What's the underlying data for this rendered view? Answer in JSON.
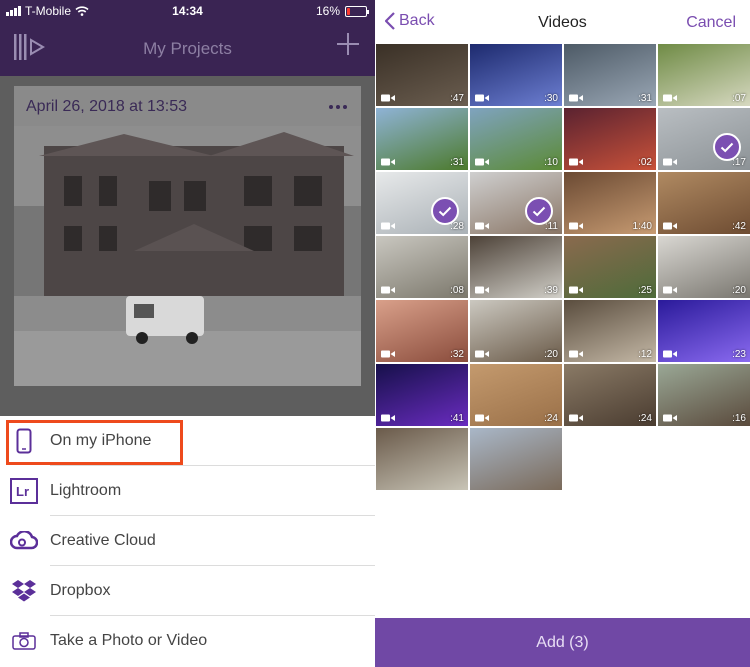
{
  "status_bar": {
    "carrier": "T-Mobile",
    "time": "14:34",
    "battery": "16%"
  },
  "left_header": {
    "title": "My Projects",
    "icons": [
      "app-logo-icon",
      "plus-icon"
    ]
  },
  "project": {
    "date": "April 26, 2018 at 13:53"
  },
  "import_menu": [
    {
      "label": "On my iPhone",
      "icon": "phone-icon"
    },
    {
      "label": "Lightroom",
      "icon": "lightroom-icon"
    },
    {
      "label": "Creative Cloud",
      "icon": "creative-cloud-icon"
    },
    {
      "label": "Dropbox",
      "icon": "dropbox-icon"
    },
    {
      "label": "Take a Photo or Video",
      "icon": "camera-icon"
    }
  ],
  "picker": {
    "back_label": "Back",
    "title": "Videos",
    "cancel_label": "Cancel",
    "add_label": "Add (3)"
  },
  "videos": [
    {
      "duration": ":47",
      "selected": false,
      "colors": [
        "#3a3026",
        "#6b5e50"
      ]
    },
    {
      "duration": ":30",
      "selected": false,
      "colors": [
        "#1d2a6e",
        "#6d7fd2"
      ]
    },
    {
      "duration": ":31",
      "selected": false,
      "colors": [
        "#4d5a66",
        "#9aa7b5"
      ]
    },
    {
      "duration": ":07",
      "selected": false,
      "colors": [
        "#6f8b45",
        "#d6d8c0"
      ]
    },
    {
      "duration": ":31",
      "selected": false,
      "colors": [
        "#8fb3d6",
        "#4c7a2c"
      ]
    },
    {
      "duration": ":10",
      "selected": false,
      "colors": [
        "#7fa3bf",
        "#5b8a35"
      ]
    },
    {
      "duration": ":02",
      "selected": false,
      "colors": [
        "#5a2230",
        "#c9523a"
      ]
    },
    {
      "duration": ":17",
      "selected": true,
      "colors": [
        "#b9bec2",
        "#8c9296"
      ]
    },
    {
      "duration": ":28",
      "selected": true,
      "colors": [
        "#e7e9ea",
        "#aab1b6"
      ]
    },
    {
      "duration": ":11",
      "selected": true,
      "colors": [
        "#cfcfcf",
        "#8a7666"
      ]
    },
    {
      "duration": "1:40",
      "selected": false,
      "colors": [
        "#6b4a33",
        "#c79b72"
      ]
    },
    {
      "duration": ":42",
      "selected": false,
      "colors": [
        "#b08a62",
        "#6e4c32"
      ]
    },
    {
      "duration": ":08",
      "selected": false,
      "colors": [
        "#c9c7c0",
        "#7c786c"
      ]
    },
    {
      "duration": ":39",
      "selected": false,
      "colors": [
        "#4d4238",
        "#d1cfc8"
      ]
    },
    {
      "duration": ":25",
      "selected": false,
      "colors": [
        "#8a6a4e",
        "#4e6b3a"
      ]
    },
    {
      "duration": ":20",
      "selected": false,
      "colors": [
        "#d9d7d2",
        "#7a7770"
      ]
    },
    {
      "duration": ":32",
      "selected": false,
      "colors": [
        "#d9a08a",
        "#8a4c3c"
      ]
    },
    {
      "duration": ":20",
      "selected": false,
      "colors": [
        "#cbc8c0",
        "#6a5a48"
      ]
    },
    {
      "duration": ":12",
      "selected": false,
      "colors": [
        "#5a4d3e",
        "#c4b8a6"
      ]
    },
    {
      "duration": ":23",
      "selected": false,
      "colors": [
        "#2a1a9a",
        "#8a6af0"
      ]
    },
    {
      "duration": ":41",
      "selected": false,
      "colors": [
        "#16104a",
        "#6a2cc0"
      ]
    },
    {
      "duration": ":24",
      "selected": false,
      "colors": [
        "#c49a6e",
        "#9a7048"
      ]
    },
    {
      "duration": ":24",
      "selected": false,
      "colors": [
        "#8a7a66",
        "#4a3c30"
      ]
    },
    {
      "duration": ":16",
      "selected": false,
      "colors": [
        "#9aa896",
        "#5a4a3c"
      ]
    },
    {
      "duration": "",
      "selected": false,
      "colors": [
        "#6a5a4a",
        "#c8c4b6"
      ]
    },
    {
      "duration": "",
      "selected": false,
      "colors": [
        "#a9b7c8",
        "#7a6a5a"
      ]
    }
  ],
  "colors": {
    "purple": "#3a2453",
    "accent": "#7b4fb2",
    "highlight": "#ee4a1c"
  }
}
